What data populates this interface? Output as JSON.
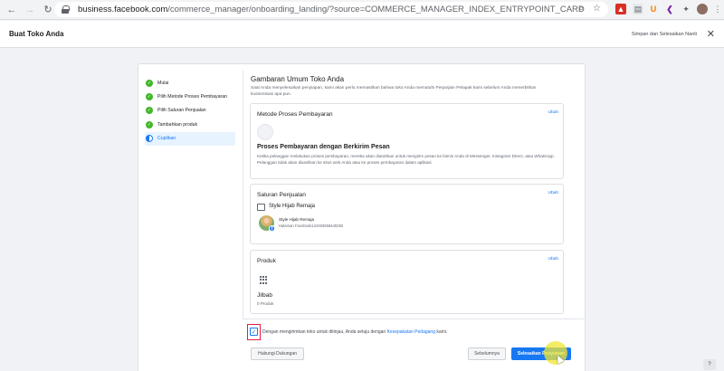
{
  "browser": {
    "url_host": "business.facebook.com",
    "url_path": "/commerce_manager/onboarding_landing/?source=COMMERCE_MANAGER_INDEX_ENTRYPOINT_CARD"
  },
  "header": {
    "title": "Buat Toko Anda",
    "save_exit": "Simpan dan Selesaikan Nanti",
    "close": "✕"
  },
  "steps": [
    {
      "label": "Mulai",
      "status": "done"
    },
    {
      "label": "Pilih Metode Proses Pembayaran",
      "status": "done"
    },
    {
      "label": "Pilih Saluran Penjualan",
      "status": "done"
    },
    {
      "label": "Tambahkan produk",
      "status": "done"
    },
    {
      "label": "Cuplikan",
      "status": "active"
    }
  ],
  "overview": {
    "title": "Gambaran Umum Toko Anda",
    "description": "Saat Anda menyelesaikan penyiapan, kami akan perlu memastikan bahwa toko Anda mematuhi Perjanjian Pelapak kami sebelum Anda menerbitkan kustomisasi apa pun."
  },
  "payment": {
    "title": "Metode Proses Pembayaran",
    "edit": "Ubah",
    "name": "Proses Pembayaran dengan Berkirim Pesan",
    "description": "Ketika pelanggan melakukan proses pembayaran, mereka akan diarahkan untuk mengirim pesan ke bisnis Anda di Messenger, Instagram Direct, atau WhatsApp. Pelanggan tidak akan diarahkan ke situs web Anda atau ke proses pembayaran dalam aplikasi."
  },
  "sales_channel": {
    "title": "Saluran Penjualan",
    "edit": "Ubah",
    "shop_name": "Style Hijab Remaja",
    "page_name": "Style Hijab Remaja",
    "page_id": "Halaman Facebook122492558440292"
  },
  "products": {
    "title": "Produk",
    "edit": "Ubah",
    "name": "Jilbab",
    "count": "0 Produk"
  },
  "agreement": {
    "checked": true,
    "text_before": "Dengan mengirimkan toko untuk ditinjau, Anda setuju dengan ",
    "link": "Kesepakatan Pedagang",
    "text_after": " kami."
  },
  "buttons": {
    "contact_support": "Hubungi Dukungan",
    "previous": "Sebelumnya",
    "finish": "Selesaikan Penyiapan"
  },
  "colors": {
    "accent": "#1877f2",
    "success": "#42b72a",
    "highlight": "#e41e3f"
  }
}
